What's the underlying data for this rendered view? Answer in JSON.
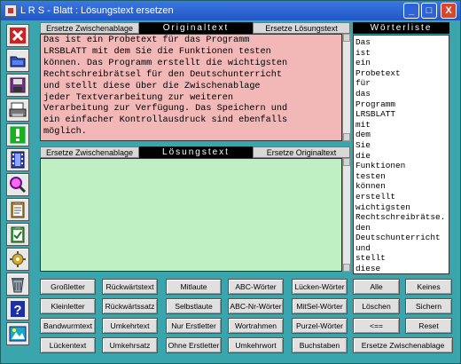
{
  "window": {
    "title": "L R S - Blatt : Lösungstext ersetzen",
    "minimize": "_",
    "maximize": "□",
    "close": "X"
  },
  "original_panel": {
    "left_button": "Ersetze Zwischenablage",
    "title": "Originaltext",
    "right_button": "Ersetze Lösungstext",
    "text": "Das ist ein Probetext für das Programm\nLRSBLATT mit dem Sie die Funktionen testen\nkönnen. Das Programm erstellt die wichtigsten\nRechtschreibrätsel für den Deutschunterricht\nund stellt diese über die Zwischenablage\njeder Textverarbeitung zur weiteren\nVerarbeitung zur Verfügung. Das Speichern und\nein einfacher Kontrollausdruck sind ebenfalls\nmöglich."
  },
  "solution_panel": {
    "left_button": "Ersetze Zwischenablage",
    "title": "Lösungstext",
    "right_button": "Ersetze Originaltext",
    "text": ""
  },
  "wordlist": {
    "title": "Wörterliste",
    "items": [
      "Das",
      "ist",
      "ein",
      "Probetext",
      "für",
      "das",
      "Programm",
      "LRSBLATT",
      "mit",
      "dem",
      "Sie",
      "die",
      "Funktionen",
      "testen",
      "können",
      "erstellt",
      "wichtigsten",
      "Rechtschreibrätse.",
      "den",
      "Deutschunterricht",
      "und",
      "stellt",
      "diese"
    ]
  },
  "buttons": [
    [
      "Großletter",
      "Rückwärtstext",
      "Mitlaute",
      "ABC-Wörter",
      "Lücken-Wörter",
      "Alle",
      "Keines"
    ],
    [
      "Kleinletter",
      "Rückwärtssatz",
      "Selbstlaute",
      "ABC-Nr-Wörter",
      "MitSel-Wörter",
      "Löschen",
      "Sichern"
    ],
    [
      "Bandwurmtext",
      "Umkehrtext",
      "Nur Erstletter",
      "Wortrahmen",
      "Purzel-Wörter",
      "<==",
      "Reset"
    ],
    [
      "Lückentext",
      "Umkehrsatz",
      "Ohne Erstletter",
      "Umkehrwort",
      "Buchstaben",
      "Ersetze Zwischenablage"
    ]
  ],
  "icons": [
    "close-icon",
    "open-folder-icon",
    "save-icon",
    "print-icon",
    "exclamation-icon",
    "film-icon",
    "magnifier-icon",
    "clipboard-icon",
    "clipboard-check-icon",
    "gear-icon",
    "recycle-bin-icon",
    "help-icon",
    "info-icon"
  ]
}
